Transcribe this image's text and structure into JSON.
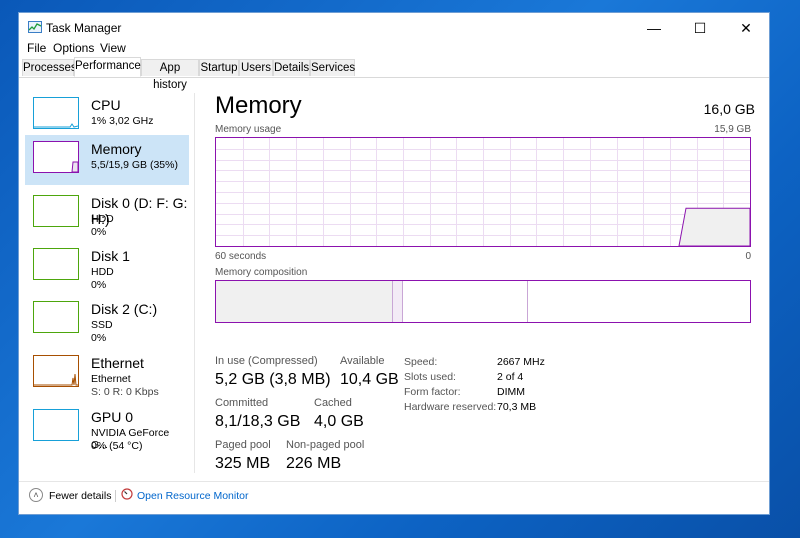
{
  "window": {
    "title": "Task Manager",
    "controls": {
      "minimize": "—",
      "maximize": "☐",
      "close": "✕"
    }
  },
  "menu": [
    "File",
    "Options",
    "View"
  ],
  "tabs": [
    "Processes",
    "Performance",
    "App history",
    "Startup",
    "Users",
    "Details",
    "Services"
  ],
  "active_tab": "Performance",
  "sidebar": [
    {
      "title": "CPU",
      "line1": "1% 3,02 GHz",
      "line2": "",
      "color": "#17a0d8"
    },
    {
      "title": "Memory",
      "line1": "5,5/15,9 GB (35%)",
      "line2": "",
      "color": "#8b12ae"
    },
    {
      "title": "Disk 0 (D: F: G: H:)",
      "line1": "HDD",
      "line2": "0%",
      "color": "#4da60c"
    },
    {
      "title": "Disk 1",
      "line1": "HDD",
      "line2": "0%",
      "color": "#4da60c"
    },
    {
      "title": "Disk 2 (C:)",
      "line1": "SSD",
      "line2": "0%",
      "color": "#4da60c"
    },
    {
      "title": "Ethernet",
      "line1": "Ethernet",
      "line2": "S: 0 R: 0 Kbps",
      "color": "#a74f01"
    },
    {
      "title": "GPU 0",
      "line1": "NVIDIA GeForce G...",
      "line2": "0% (54 °C)",
      "color": "#17a0d8"
    }
  ],
  "main": {
    "title": "Memory",
    "total": "16,0 GB",
    "graph_label": "Memory usage",
    "graph_max": "15,9 GB",
    "x_left": "60 seconds",
    "x_right": "0",
    "composition_label": "Memory composition",
    "usage_fraction": 0.35
  },
  "stats": {
    "in_use_label": "In use (Compressed)",
    "in_use_value": "5,2 GB (3,8 MB)",
    "available_label": "Available",
    "available_value": "10,4 GB",
    "committed_label": "Committed",
    "committed_value": "8,1/18,3 GB",
    "cached_label": "Cached",
    "cached_value": "4,0 GB",
    "paged_label": "Paged pool",
    "paged_value": "325 MB",
    "nonpaged_label": "Non-paged pool",
    "nonpaged_value": "226 MB"
  },
  "info": [
    {
      "label": "Speed:",
      "value": "2667 MHz"
    },
    {
      "label": "Slots used:",
      "value": "2 of 4"
    },
    {
      "label": "Form factor:",
      "value": "DIMM"
    },
    {
      "label": "Hardware reserved:",
      "value": "70,3 MB"
    }
  ],
  "footer": {
    "fewer_details": "Fewer details",
    "open_monitor": "Open Resource Monitor"
  },
  "colors": {
    "memory": "#8b12ae",
    "selected_bg": "#cce4f7",
    "link": "#0066cc"
  }
}
